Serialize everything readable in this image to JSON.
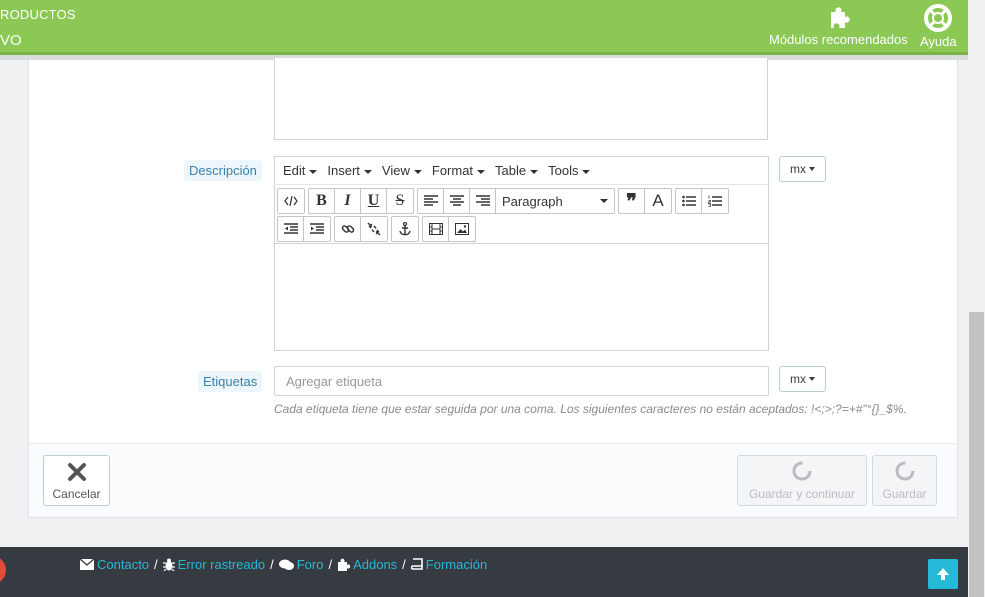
{
  "header": {
    "breadcrumb": "RODUCTOS",
    "page_title": "VO",
    "recommended_modules": "Módulos recomendados",
    "help": "Ayuda"
  },
  "form": {
    "description_label": "Descripción",
    "tags_label": "Etiquetas",
    "tags_placeholder": "Agregar etiqueta",
    "tags_help": "Cada etiqueta tiene que estar seguida por una coma. Los siguientes caracteres no están aceptados: !<;>;?=+#\"°{}_$%.",
    "lang_selector": "mx"
  },
  "editor": {
    "menus": [
      "Edit",
      "Insert",
      "View",
      "Format",
      "Table",
      "Tools"
    ],
    "format_select": "Paragraph"
  },
  "actions": {
    "cancel": "Cancelar",
    "save_continue": "Guardar y continuar",
    "save": "Guardar"
  },
  "footer": {
    "links": [
      "Contacto",
      "Error rastreado",
      "Foro",
      "Addons",
      "Formación"
    ]
  },
  "colors": {
    "header_bg": "#8bc954",
    "footer_bg": "#363a41",
    "link": "#25b9d7"
  }
}
